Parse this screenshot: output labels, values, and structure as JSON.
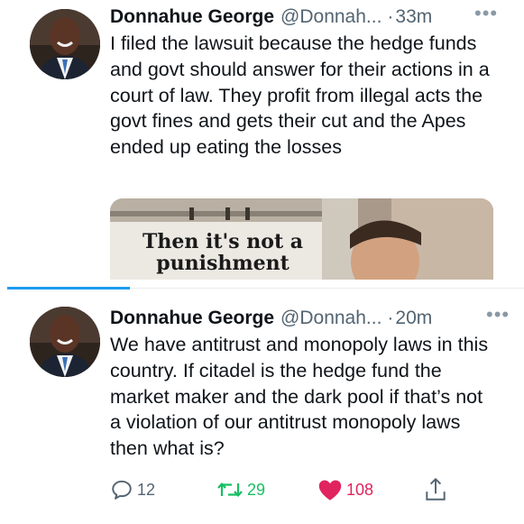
{
  "tweets": [
    {
      "author": "Donnahue George",
      "handle": "@Donnah...",
      "separator": "·",
      "time": "33m",
      "text": "I filed the lawsuit because the hedge funds and govt should answer for their actions in a court of law. They profit from illegal acts the govt fines and gets their cut and the Apes ended up eating the losses",
      "media_text": "Then it's not a punishment"
    },
    {
      "author": "Donnahue George",
      "handle": "@Donnah...",
      "separator": "·",
      "time": "20m",
      "text": "We have antitrust and monopoly laws in this country. If citadel is the hedge fund the market maker and the dark pool if that’s not a violation of our antitrust monopoly laws then what is?",
      "replies": "12",
      "retweets": "29",
      "likes": "108"
    }
  ],
  "colors": {
    "accent": "#1d9bf0",
    "retweet": "#17bf63",
    "like": "#e0245e",
    "secondary_text": "#536471"
  },
  "icons": [
    "more-icon",
    "reply-icon",
    "retweet-icon",
    "heart-icon",
    "share-icon"
  ]
}
